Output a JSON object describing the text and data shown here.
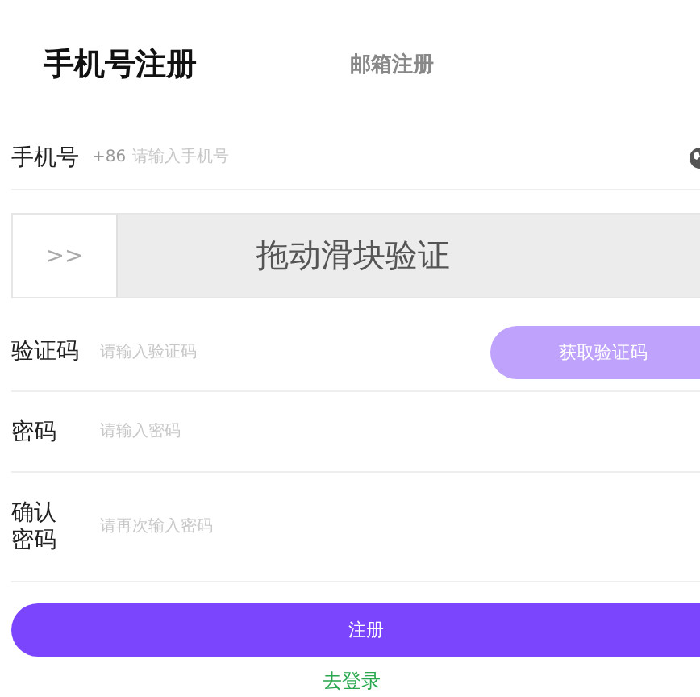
{
  "tabs": [
    {
      "label": "手机号注册",
      "selected": true
    },
    {
      "label": "邮箱注册",
      "selected": false
    }
  ],
  "phone": {
    "label": "手机号",
    "prefix": "+86",
    "placeholder": "请输入手机号"
  },
  "slider": {
    "handle": ">>",
    "text": "拖动滑块验证"
  },
  "code": {
    "label": "验证码",
    "placeholder": "请输入验证码",
    "button": "获取验证码"
  },
  "password": {
    "label": "密码",
    "placeholder": "请输入密码"
  },
  "confirm": {
    "label": "确认密码",
    "placeholder": "请再次输入密码"
  },
  "submit": "注册",
  "login_link": "去登录"
}
